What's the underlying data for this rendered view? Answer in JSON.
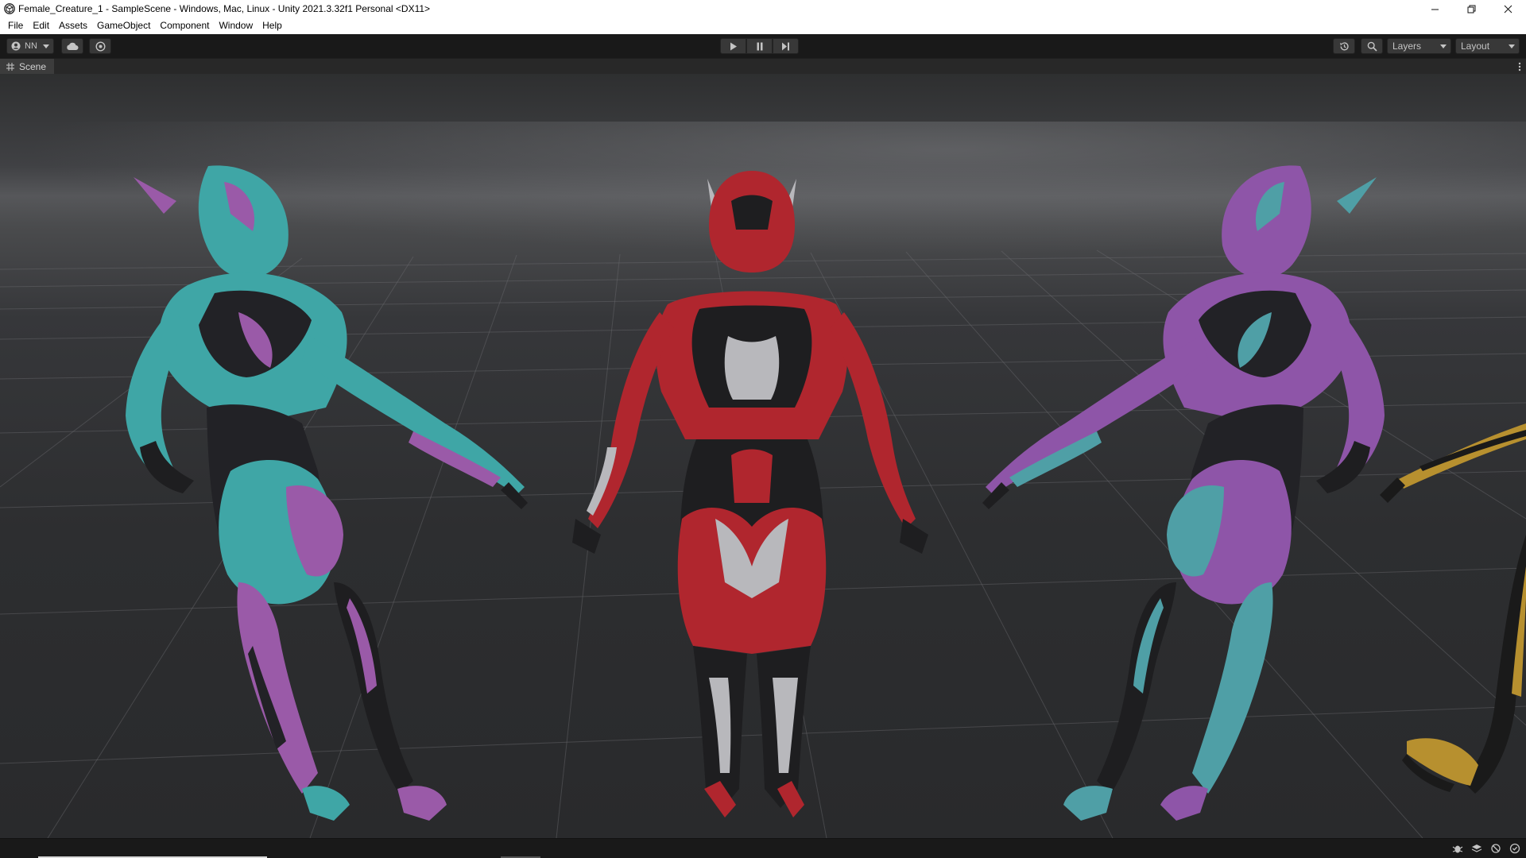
{
  "window": {
    "title": "Female_Creature_1 - SampleScene - Windows, Mac, Linux - Unity 2021.3.32f1 Personal <DX11>",
    "app_icon": "unity-icon",
    "controls": [
      "minimize-icon",
      "restore-icon",
      "close-icon"
    ]
  },
  "menu": {
    "items": [
      "File",
      "Edit",
      "Assets",
      "GameObject",
      "Component",
      "Window",
      "Help"
    ]
  },
  "toolbar": {
    "account_label": "NN",
    "account_icon": "account-icon",
    "cloud_icon": "cloud-icon",
    "collab_icon": "collab-icon",
    "playback": [
      "play-icon",
      "pause-icon",
      "step-icon"
    ],
    "history_icon": "history-icon",
    "search_icon": "search-icon",
    "layers_label": "Layers",
    "layout_label": "Layout"
  },
  "scene_tab": {
    "label": "Scene",
    "icon": "grid-icon"
  },
  "viewport": {
    "models": [
      {
        "name": "teal-purple-creature",
        "primary": "#3fa6a6",
        "secondary": "#9a5aa8"
      },
      {
        "name": "red-silver-creature",
        "primary": "#b0262e",
        "secondary": "#b8b8bc"
      },
      {
        "name": "purple-teal-creature",
        "primary": "#8e55a8",
        "secondary": "#4f9fa6"
      },
      {
        "name": "gold-black-creature",
        "primary": "#b7902f",
        "secondary": "#1a1a1a"
      }
    ]
  },
  "status": {
    "icons": [
      "debug-icon",
      "layers-status-icon",
      "render-icon",
      "auto-refresh-icon"
    ]
  },
  "colors": {
    "editor_bg": "#191919",
    "panel_bg": "#282828",
    "button_bg": "#383838",
    "text": "#c4c4c4"
  }
}
